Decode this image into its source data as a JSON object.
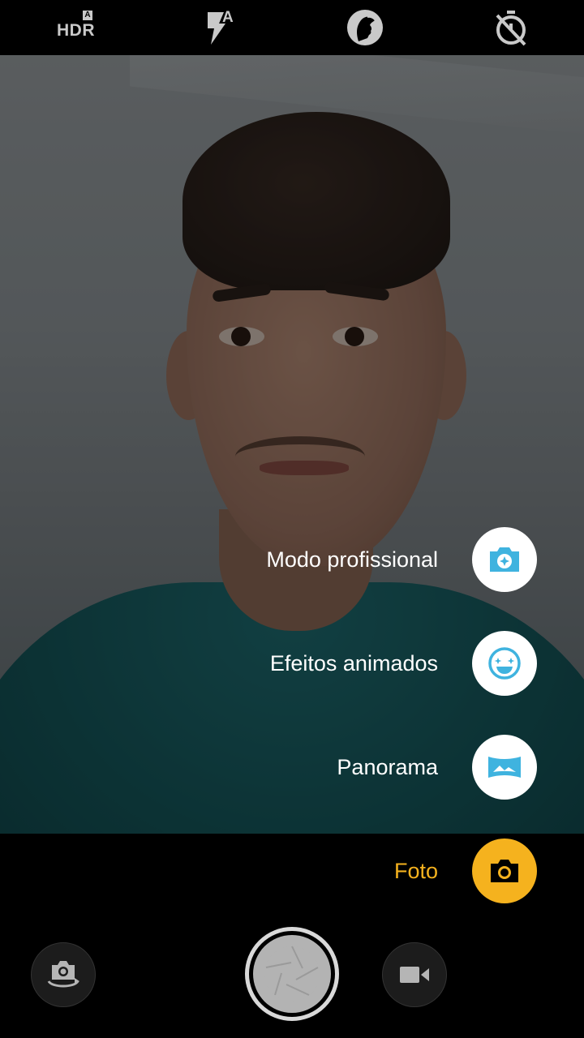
{
  "topbar": {
    "hdr_label": "HDR",
    "hdr_badge": "A",
    "flash_badge": "A",
    "icons": [
      "hdr-auto-icon",
      "flash-auto-icon",
      "beauty-face-icon",
      "timer-off-icon"
    ]
  },
  "modes": [
    {
      "label": "Modo profissional",
      "icon": "pro-camera-icon",
      "active": false
    },
    {
      "label": "Efeitos animados",
      "icon": "animated-face-icon",
      "active": false
    },
    {
      "label": "Panorama",
      "icon": "panorama-icon",
      "active": false
    },
    {
      "label": "Foto",
      "icon": "photo-camera-icon",
      "active": true
    }
  ],
  "bottom": {
    "icons": [
      "switch-camera-icon",
      "shutter-icon",
      "video-camera-icon"
    ]
  },
  "colors": {
    "accent": "#f5b21e",
    "mode_icon": "#3fb3df",
    "background": "#000000"
  }
}
